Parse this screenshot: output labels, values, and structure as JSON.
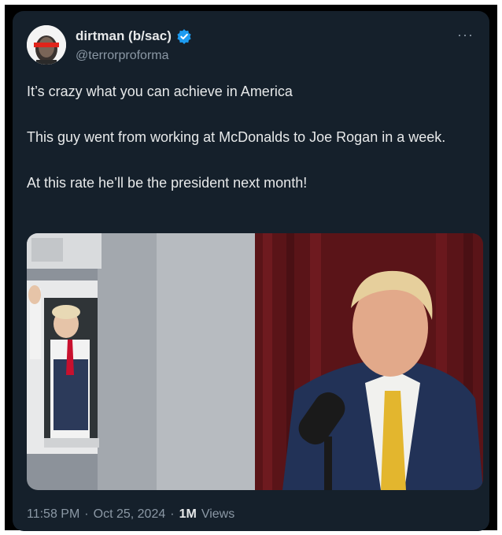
{
  "tweet": {
    "display_name": "dirtman (b/sac)",
    "handle": "@terrorproforma",
    "more_icon": "more-dots-icon",
    "verified_icon": "verified-badge-icon",
    "paragraphs": [
      "It’s crazy what you can achieve in America",
      "This guy went from working at McDonalds to Joe Rogan in a week.",
      "At this rate he’ll be the president next month!"
    ],
    "time": "11:58 PM",
    "sep1": "·",
    "date": "Oct 25, 2024",
    "sep2": "·",
    "views_count": "1M",
    "views_label": "Views"
  },
  "colors": {
    "card_bg": "#15202b",
    "text_primary": "#e7e9ea",
    "text_secondary": "#8b98a5",
    "verified_blue": "#1d9bf0"
  }
}
